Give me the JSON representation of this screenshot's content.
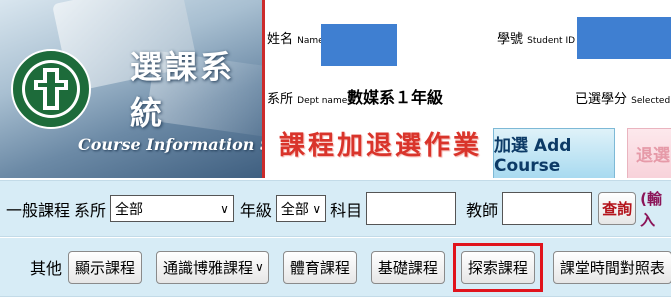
{
  "banner": {
    "title": "選課系統",
    "subtitle": "Course Information System",
    "logo_name": "asia-university-seal"
  },
  "student": {
    "name_label": "姓名",
    "name_label_en": "Name",
    "student_id_label": "學號",
    "student_id_label_en": "Student ID",
    "dept_label": "系所",
    "dept_label_en": "Dept name",
    "dept_value": "數媒系１年級",
    "credits_label": "已選學分",
    "credits_label_en": "Selected Cr"
  },
  "page": {
    "heading": "課程加退選作業",
    "tab_add": "加選 Add Course",
    "tab_drop": "退選"
  },
  "general_search": {
    "section_label": "一般課程",
    "dept_label": "系所",
    "dept_value": "全部",
    "grade_label": "年級",
    "grade_value": "全部",
    "subject_label": "科目",
    "subject_value": "",
    "teacher_label": "教師",
    "teacher_value": "",
    "query_button": "查詢",
    "hint": "(輸入"
  },
  "other": {
    "section_label": "其他",
    "buttons": {
      "show_courses": "顯示課程",
      "general_education": "通識博雅課程",
      "physical_education": "體育課程",
      "basic_courses": "基礎課程",
      "exploration_courses": "探索課程",
      "timetable": "課堂時間對照表"
    }
  },
  "colors": {
    "accent_red": "#e0141d",
    "bar_bg": "#d7ecf6",
    "mask_blue": "#3f7fd1",
    "heading_red": "#d9342b"
  }
}
